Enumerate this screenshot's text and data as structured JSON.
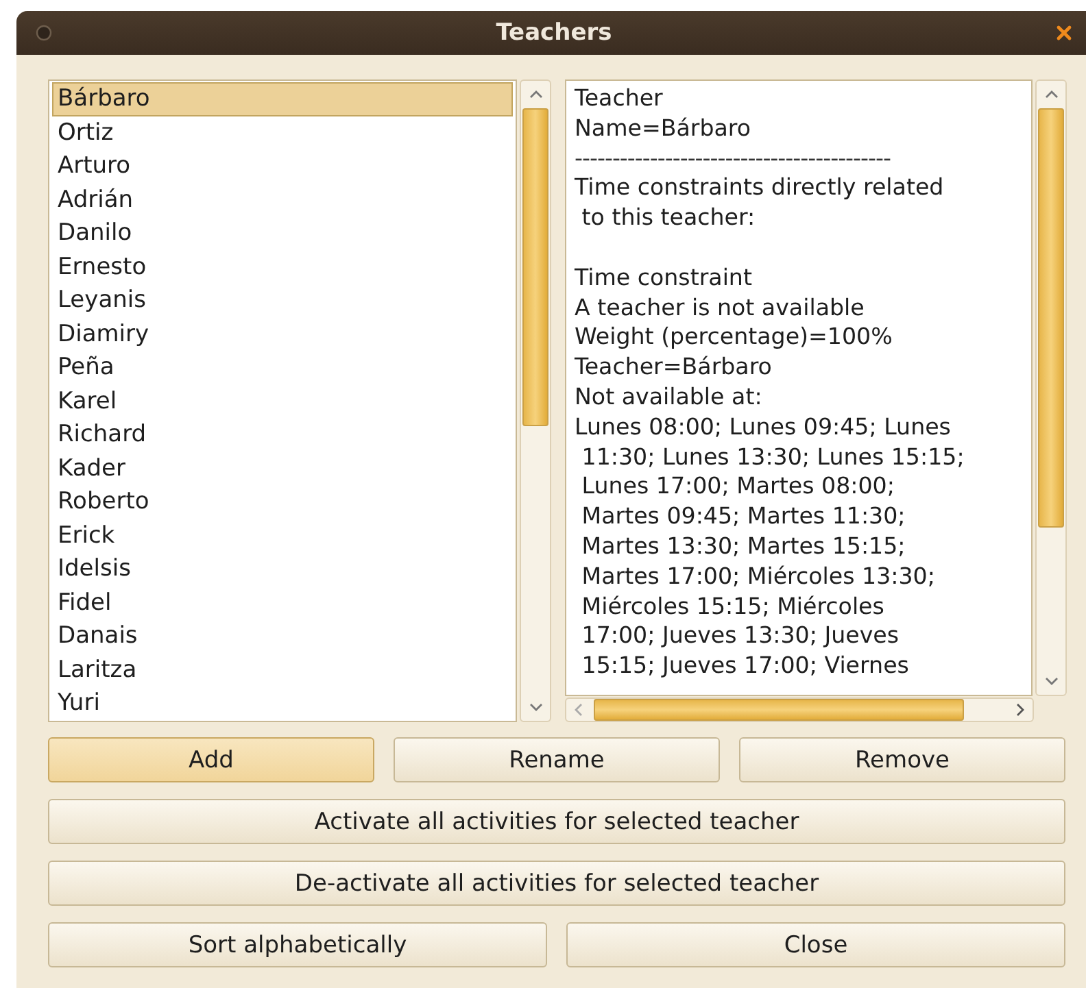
{
  "window": {
    "title": "Teachers"
  },
  "teachers": [
    {
      "name": "Bárbaro",
      "selected": true
    },
    {
      "name": "Ortiz",
      "selected": false
    },
    {
      "name": "Arturo",
      "selected": false
    },
    {
      "name": "Adrián",
      "selected": false
    },
    {
      "name": "Danilo",
      "selected": false
    },
    {
      "name": "Ernesto",
      "selected": false
    },
    {
      "name": "Leyanis",
      "selected": false
    },
    {
      "name": "Diamiry",
      "selected": false
    },
    {
      "name": "Peña",
      "selected": false
    },
    {
      "name": "Karel",
      "selected": false
    },
    {
      "name": "Richard",
      "selected": false
    },
    {
      "name": "Kader",
      "selected": false
    },
    {
      "name": "Roberto",
      "selected": false
    },
    {
      "name": "Erick",
      "selected": false
    },
    {
      "name": "Idelsis",
      "selected": false
    },
    {
      "name": "Fidel",
      "selected": false
    },
    {
      "name": "Danais",
      "selected": false
    },
    {
      "name": "Laritza",
      "selected": false
    },
    {
      "name": "Yuri",
      "selected": false
    }
  ],
  "details": {
    "lines": [
      {
        "kind": "text",
        "text": "Teacher"
      },
      {
        "kind": "text",
        "text": "Name=Bárbaro"
      },
      {
        "kind": "separator",
        "text": "------------------------------------------"
      },
      {
        "kind": "text",
        "text": "Time constraints directly related"
      },
      {
        "kind": "text",
        "text": " to this teacher:"
      },
      {
        "kind": "blank"
      },
      {
        "kind": "text",
        "text": "Time constraint"
      },
      {
        "kind": "text",
        "text": "A teacher is not available"
      },
      {
        "kind": "text",
        "text": "Weight (percentage)=100%"
      },
      {
        "kind": "text",
        "text": "Teacher=Bárbaro"
      },
      {
        "kind": "text",
        "text": "Not available at:"
      },
      {
        "kind": "text",
        "text": "Lunes 08:00; Lunes 09:45; Lunes"
      },
      {
        "kind": "text",
        "text": " 11:30; Lunes 13:30; Lunes 15:15;"
      },
      {
        "kind": "text",
        "text": " Lunes 17:00; Martes 08:00;"
      },
      {
        "kind": "text",
        "text": " Martes 09:45; Martes 11:30;"
      },
      {
        "kind": "text",
        "text": " Martes 13:30; Martes 15:15;"
      },
      {
        "kind": "text",
        "text": " Martes 17:00; Miércoles 13:30;"
      },
      {
        "kind": "text",
        "text": " Miércoles 15:15; Miércoles"
      },
      {
        "kind": "text",
        "text": " 17:00; Jueves 13:30; Jueves"
      },
      {
        "kind": "text",
        "text": " 15:15; Jueves 17:00; Viernes"
      }
    ]
  },
  "button_rows": [
    [
      {
        "label": "Add",
        "default": true
      },
      {
        "label": "Rename",
        "default": false
      },
      {
        "label": "Remove",
        "default": false
      }
    ],
    [
      {
        "label": "Activate all activities for selected teacher",
        "default": false
      }
    ],
    [
      {
        "label": "De-activate all activities for selected teacher",
        "default": false
      }
    ],
    [
      {
        "label": "Sort alphabetically",
        "default": false
      },
      {
        "label": "Close",
        "default": false
      }
    ]
  ]
}
